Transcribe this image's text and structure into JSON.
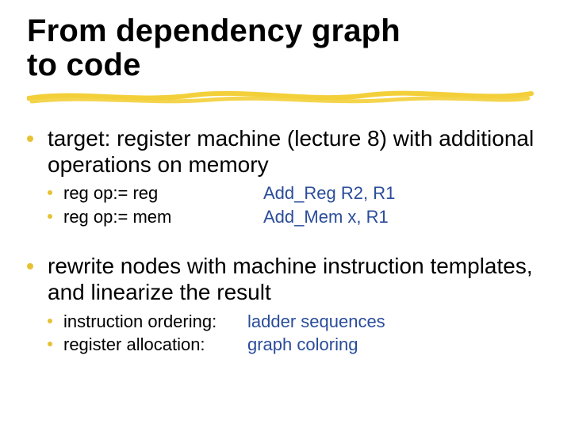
{
  "title": {
    "line1": "From dependency graph",
    "line2": "to code"
  },
  "bullets": {
    "b1": {
      "text": "target: register machine (lecture 8) with additional operations on memory",
      "sub": [
        {
          "left": "reg op:= reg",
          "right": "Add_Reg R2, R1"
        },
        {
          "left": "reg op:= mem",
          "right": "Add_Mem x, R1"
        }
      ]
    },
    "b2": {
      "text": "rewrite nodes with machine instruction templates, and linearize the result",
      "sub": [
        {
          "left": "instruction ordering:",
          "right": "ladder sequences"
        },
        {
          "left": "register allocation:",
          "right": "graph coloring"
        }
      ]
    }
  }
}
